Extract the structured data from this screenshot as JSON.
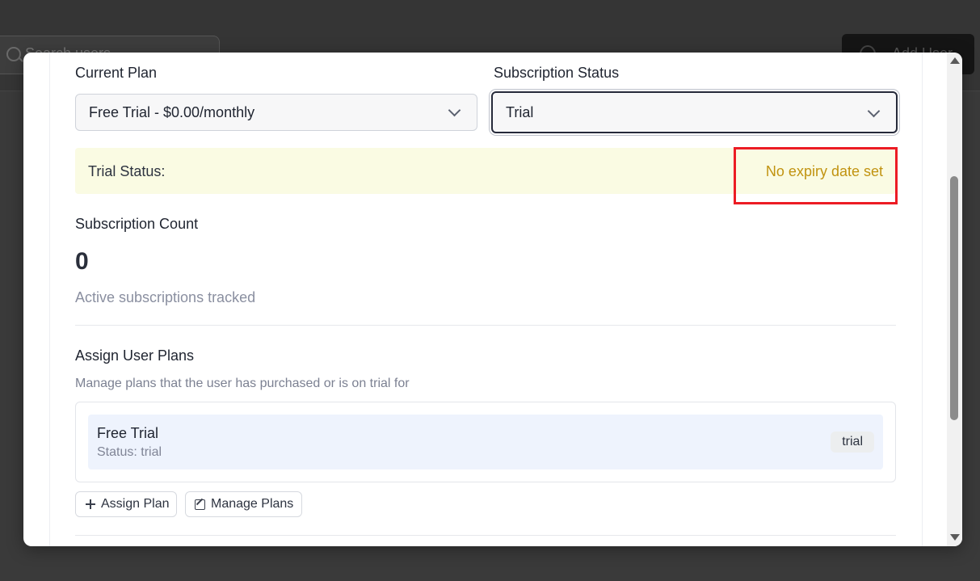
{
  "background": {
    "search_placeholder": "Search users",
    "add_button_label": "Add User"
  },
  "form": {
    "current_plan_label": "Current Plan",
    "current_plan_value": "Free Trial - $0.00/monthly",
    "subscription_status_label": "Subscription Status",
    "subscription_status_value": "Trial"
  },
  "trial": {
    "label": "Trial Status:",
    "status": "No expiry date set",
    "status_color": "#c19310",
    "highlight_color": "#ec1c24"
  },
  "subscription_count": {
    "title": "Subscription Count",
    "value": "0",
    "caption": "Active subscriptions tracked"
  },
  "assign_plans": {
    "title": "Assign User Plans",
    "description": "Manage plans that the user has purchased or is on trial for",
    "plans": [
      {
        "name": "Free Trial",
        "status": "Status: trial",
        "badge": "trial"
      }
    ],
    "assign_button": "Assign Plan",
    "manage_button": "Manage Plans"
  }
}
